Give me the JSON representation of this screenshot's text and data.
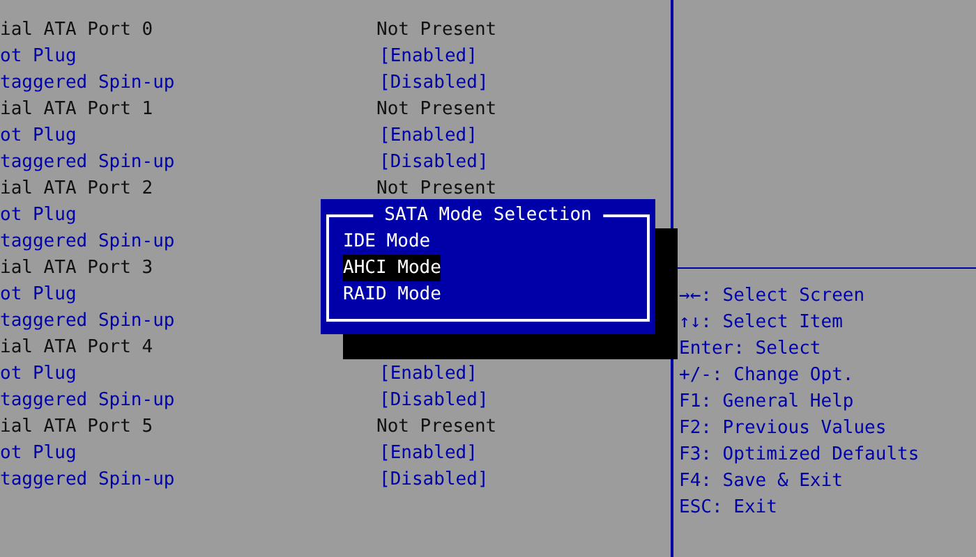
{
  "settings": [
    {
      "kind": "header",
      "label": "ial ATA Port 0",
      "value": "Not Present"
    },
    {
      "kind": "option",
      "label": "ot Plug",
      "value": "[Enabled]"
    },
    {
      "kind": "option",
      "label": "taggered Spin-up",
      "value": "[Disabled]"
    },
    {
      "kind": "header",
      "label": "ial ATA Port 1",
      "value": "Not Present"
    },
    {
      "kind": "option",
      "label": "ot Plug",
      "value": "[Enabled]"
    },
    {
      "kind": "option",
      "label": "taggered Spin-up",
      "value": "[Disabled]"
    },
    {
      "kind": "header",
      "label": "ial ATA Port 2",
      "value": "Not Present"
    },
    {
      "kind": "option",
      "label": "ot Plug"
    },
    {
      "kind": "option",
      "label": "taggered Spin-up"
    },
    {
      "kind": "header",
      "label": "ial ATA Port 3"
    },
    {
      "kind": "option",
      "label": "ot Plug"
    },
    {
      "kind": "option",
      "label": "taggered Spin-up"
    },
    {
      "kind": "header",
      "label": "ial ATA Port 4"
    },
    {
      "kind": "option",
      "label": "ot Plug",
      "value": "[Enabled]"
    },
    {
      "kind": "option",
      "label": "taggered Spin-up",
      "value": "[Disabled]"
    },
    {
      "kind": "header",
      "label": "ial ATA Port 5",
      "value": "Not Present"
    },
    {
      "kind": "option",
      "label": "ot Plug",
      "value": "[Enabled]"
    },
    {
      "kind": "option",
      "label": "taggered Spin-up",
      "value": "[Disabled]"
    }
  ],
  "popup": {
    "title": "SATA Mode Selection",
    "items": [
      {
        "label": "IDE Mode",
        "selected": false
      },
      {
        "label": "AHCI Mode",
        "selected": true
      },
      {
        "label": "RAID Mode",
        "selected": false
      }
    ]
  },
  "help": [
    "→←: Select Screen",
    "↑↓: Select Item",
    "Enter: Select",
    "+/-: Change Opt.",
    "F1: General Help",
    "F2: Previous Values",
    "F3: Optimized Defaults",
    "F4: Save & Exit",
    "ESC: Exit"
  ]
}
